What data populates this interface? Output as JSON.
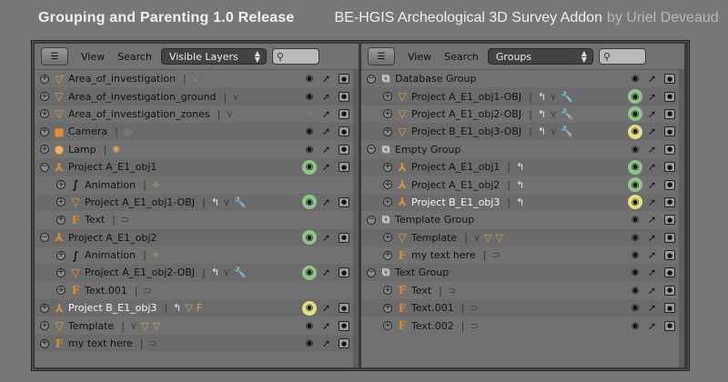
{
  "banner": {
    "title": "Grouping and Parenting 1.0 Release",
    "subtitle": "BE-HGIS Archeological 3D Survey Addon",
    "author": "by Uriel Deveaud"
  },
  "left": {
    "view_label": "View",
    "search_label": "Search",
    "display_mode": "Visible Layers",
    "search_value": "",
    "rows": [
      {
        "label": "Area_of_investigation",
        "indent": 0,
        "expander": "+",
        "icon": "mesh-icon",
        "glyph": "▽",
        "subs": [
          {
            "glyph": "⋎",
            "cls": "ghost",
            "name": "mesh-data-icon"
          }
        ],
        "eye": "on"
      },
      {
        "label": "Area_of_investigation_ground",
        "indent": 0,
        "expander": "+",
        "icon": "mesh-icon",
        "glyph": "▽",
        "subs": [
          {
            "glyph": "⋎",
            "cls": "dim",
            "name": "mesh-data-icon"
          }
        ],
        "eye": "on"
      },
      {
        "label": "Area_of_investigation_zones",
        "indent": 0,
        "expander": "+",
        "icon": "mesh-icon",
        "glyph": "▽",
        "subs": [
          {
            "glyph": "⋎",
            "cls": "dim",
            "name": "mesh-data-icon"
          }
        ],
        "eye": "off"
      },
      {
        "label": "Camera",
        "indent": 0,
        "expander": "+",
        "icon": "camera-icon",
        "glyph": "■",
        "subs": [
          {
            "glyph": "◎",
            "cls": "ghost",
            "name": "camera-data-icon"
          }
        ],
        "eye": "on"
      },
      {
        "label": "Lamp",
        "indent": 0,
        "expander": "+",
        "icon": "lamp-icon",
        "glyph": "●",
        "subs": [
          {
            "glyph": "✺",
            "cls": "",
            "name": "lamp-data-icon"
          }
        ],
        "eye": "on"
      },
      {
        "label": "Project A_E1_obj1",
        "indent": 0,
        "expander": "−",
        "icon": "empty-icon",
        "glyph": "⅄",
        "subs": [],
        "eye": "green"
      },
      {
        "label": "Animation",
        "indent": 1,
        "expander": "+",
        "icon": "animation-icon",
        "glyph": "∫",
        "subs": [
          {
            "glyph": "✧",
            "cls": "",
            "name": "action-icon"
          }
        ],
        "eye": "none"
      },
      {
        "label": "Project A_E1_obj1-OBJ",
        "indent": 1,
        "expander": "+",
        "icon": "mesh-icon",
        "glyph": "▽",
        "subs": [
          {
            "glyph": "↰",
            "cls": "white",
            "name": "constraint-icon"
          },
          {
            "glyph": "⋎",
            "cls": "dim",
            "name": "mesh-data-icon"
          },
          {
            "glyph": "🔧",
            "cls": "blue",
            "name": "modifier-icon"
          }
        ],
        "eye": "green"
      },
      {
        "label": "Text",
        "indent": 1,
        "expander": "+",
        "icon": "font-icon",
        "glyph": "F",
        "subs": [
          {
            "glyph": "⊃",
            "cls": "dim",
            "name": "font-data-icon"
          }
        ],
        "eye": "none"
      },
      {
        "label": "Project A_E1_obj2",
        "indent": 0,
        "expander": "−",
        "icon": "empty-icon",
        "glyph": "⅄",
        "subs": [],
        "eye": "green"
      },
      {
        "label": "Animation",
        "indent": 1,
        "expander": "+",
        "icon": "animation-icon",
        "glyph": "∫",
        "subs": [
          {
            "glyph": "✧",
            "cls": "",
            "name": "action-icon"
          }
        ],
        "eye": "none"
      },
      {
        "label": "Project A_E1_obj2-OBJ",
        "indent": 1,
        "expander": "+",
        "icon": "mesh-icon",
        "glyph": "▽",
        "subs": [
          {
            "glyph": "↰",
            "cls": "white",
            "name": "constraint-icon"
          },
          {
            "glyph": "⋎",
            "cls": "dim",
            "name": "mesh-data-icon"
          },
          {
            "glyph": "🔧",
            "cls": "blue",
            "name": "modifier-icon"
          }
        ],
        "eye": "green"
      },
      {
        "label": "Text.001",
        "indent": 1,
        "expander": "+",
        "icon": "font-icon",
        "glyph": "F",
        "subs": [
          {
            "glyph": "⊃",
            "cls": "dim",
            "name": "font-data-icon"
          }
        ],
        "eye": "none"
      },
      {
        "label": "Project B_E1_obj3",
        "indent": 0,
        "expander": "+",
        "icon": "empty-icon",
        "glyph": "⅄",
        "subs": [
          {
            "glyph": "↰",
            "cls": "white",
            "name": "constraint-icon"
          },
          {
            "glyph": "▽",
            "cls": "",
            "name": "mesh-child-icon"
          },
          {
            "glyph": "F",
            "cls": "",
            "name": "font-child-icon"
          }
        ],
        "eye": "yellow",
        "selected": true
      },
      {
        "label": "Template",
        "indent": 0,
        "expander": "+",
        "icon": "mesh-icon",
        "glyph": "▽",
        "subs": [
          {
            "glyph": "⋎",
            "cls": "dim",
            "name": "mesh-data-icon"
          },
          {
            "glyph": "▽",
            "cls": "",
            "name": "mesh-child-icon"
          },
          {
            "glyph": "▽",
            "cls": "",
            "name": "mesh-child-icon"
          }
        ],
        "eye": "on"
      },
      {
        "label": "my text here",
        "indent": 0,
        "expander": "+",
        "icon": "font-icon",
        "glyph": "F",
        "subs": [
          {
            "glyph": "⊃",
            "cls": "dim",
            "name": "font-data-icon"
          }
        ],
        "eye": "on"
      }
    ]
  },
  "right": {
    "view_label": "View",
    "search_label": "Search",
    "display_mode": "Groups",
    "search_value": "",
    "rows": [
      {
        "label": "Database Group",
        "indent": 0,
        "expander": "−",
        "icon": "group-icon",
        "glyph": "⧉",
        "subs": [],
        "eye": "on"
      },
      {
        "label": "Project A_E1_obj1-OBJ",
        "indent": 1,
        "expander": "+",
        "icon": "mesh-icon",
        "glyph": "▽",
        "subs": [
          {
            "glyph": "↰",
            "cls": "white",
            "name": "constraint-icon"
          },
          {
            "glyph": "⋎",
            "cls": "dim",
            "name": "mesh-data-icon"
          },
          {
            "glyph": "🔧",
            "cls": "blue",
            "name": "modifier-icon"
          }
        ],
        "eye": "green"
      },
      {
        "label": "Project A_E1_obj2-OBJ",
        "indent": 1,
        "expander": "+",
        "icon": "mesh-icon",
        "glyph": "▽",
        "subs": [
          {
            "glyph": "↰",
            "cls": "white",
            "name": "constraint-icon"
          },
          {
            "glyph": "⋎",
            "cls": "dim",
            "name": "mesh-data-icon"
          },
          {
            "glyph": "🔧",
            "cls": "blue",
            "name": "modifier-icon"
          }
        ],
        "eye": "green"
      },
      {
        "label": "Project B_E1_obj3-OBJ",
        "indent": 1,
        "expander": "+",
        "icon": "mesh-icon",
        "glyph": "▽",
        "subs": [
          {
            "glyph": "↰",
            "cls": "white",
            "name": "constraint-icon"
          },
          {
            "glyph": "⋎",
            "cls": "dim",
            "name": "mesh-data-icon"
          },
          {
            "glyph": "🔧",
            "cls": "blue",
            "name": "modifier-icon"
          }
        ],
        "eye": "yellow"
      },
      {
        "label": "Empty Group",
        "indent": 0,
        "expander": "−",
        "icon": "group-icon",
        "glyph": "⧉",
        "subs": [],
        "eye": "on"
      },
      {
        "label": "Project A_E1_obj1",
        "indent": 1,
        "expander": "+",
        "icon": "empty-icon",
        "glyph": "⅄",
        "subs": [
          {
            "glyph": "↰",
            "cls": "white",
            "name": "constraint-icon"
          }
        ],
        "eye": "green"
      },
      {
        "label": "Project A_E1_obj2",
        "indent": 1,
        "expander": "+",
        "icon": "empty-icon",
        "glyph": "⅄",
        "subs": [
          {
            "glyph": "↰",
            "cls": "white",
            "name": "constraint-icon"
          }
        ],
        "eye": "green"
      },
      {
        "label": "Project B_E1_obj3",
        "indent": 1,
        "expander": "+",
        "icon": "empty-icon",
        "glyph": "⅄",
        "subs": [
          {
            "glyph": "↰",
            "cls": "white",
            "name": "constraint-icon"
          }
        ],
        "eye": "yellow",
        "selected": true
      },
      {
        "label": "Template Group",
        "indent": 0,
        "expander": "−",
        "icon": "group-icon",
        "glyph": "⧉",
        "subs": [],
        "eye": "on"
      },
      {
        "label": "Template",
        "indent": 1,
        "expander": "+",
        "icon": "mesh-icon",
        "glyph": "▽",
        "subs": [
          {
            "glyph": "⋎",
            "cls": "dim",
            "name": "mesh-data-icon"
          },
          {
            "glyph": "▽",
            "cls": "",
            "name": "mesh-child-icon"
          },
          {
            "glyph": "▽",
            "cls": "",
            "name": "mesh-child-icon"
          }
        ],
        "eye": "on"
      },
      {
        "label": "my text here",
        "indent": 1,
        "expander": "+",
        "icon": "font-icon",
        "glyph": "F",
        "subs": [
          {
            "glyph": "⊃",
            "cls": "dim",
            "name": "font-data-icon"
          }
        ],
        "eye": "on"
      },
      {
        "label": "Text Group",
        "indent": 0,
        "expander": "−",
        "icon": "group-icon",
        "glyph": "⧉",
        "subs": [],
        "eye": "on"
      },
      {
        "label": "Text",
        "indent": 1,
        "expander": "+",
        "icon": "font-icon",
        "glyph": "F",
        "subs": [
          {
            "glyph": "⊃",
            "cls": "dim",
            "name": "font-data-icon"
          }
        ],
        "eye": "on"
      },
      {
        "label": "Text.001",
        "indent": 1,
        "expander": "+",
        "icon": "font-icon",
        "glyph": "F",
        "subs": [
          {
            "glyph": "⊃",
            "cls": "dim",
            "name": "font-data-icon"
          }
        ],
        "eye": "on"
      },
      {
        "label": "Text.002",
        "indent": 1,
        "expander": "+",
        "icon": "font-icon",
        "glyph": "F",
        "subs": [
          {
            "glyph": "⊃",
            "cls": "dim",
            "name": "font-data-icon"
          }
        ],
        "eye": "on"
      }
    ]
  },
  "colors": {
    "panel_bg": "#727272",
    "eye_green": "#8fc48a",
    "eye_yellow": "#e5df8a",
    "icon_orange": "#e59a3a",
    "modifier_blue": "#5a8ad8"
  }
}
